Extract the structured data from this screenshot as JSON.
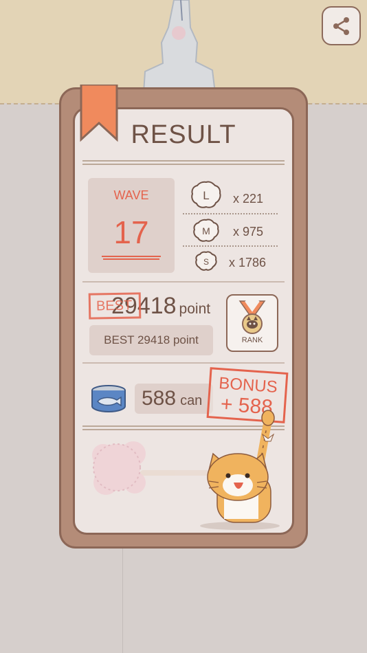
{
  "header": {
    "share_icon": "share-icon"
  },
  "result": {
    "title": "RESULT",
    "wave": {
      "label": "WAVE",
      "value": "17"
    },
    "counts": [
      {
        "badge": "L",
        "text": "x 221"
      },
      {
        "badge": "M",
        "text": "x 975"
      },
      {
        "badge": "S",
        "text": "x 1786"
      }
    ],
    "score": {
      "best_stamp": "BEST",
      "value": "29418",
      "unit": "point",
      "best_text": "BEST 29418 point"
    },
    "rank": {
      "label": "RANK",
      "icon": "rank-medal-icon"
    },
    "cans": {
      "value": "588",
      "unit": "can",
      "icon": "tuna-can-icon"
    },
    "bonus": {
      "label": "BONUS",
      "value": "+ 588"
    }
  },
  "colors": {
    "accent_red": "#e4634d",
    "text_brown": "#6e5246",
    "card_frame": "#b48c78",
    "card_paper": "#ede5e2",
    "bookmark": "#f08a5d",
    "top_band": "#e3d4b6",
    "floor": "#d6cfcc"
  }
}
